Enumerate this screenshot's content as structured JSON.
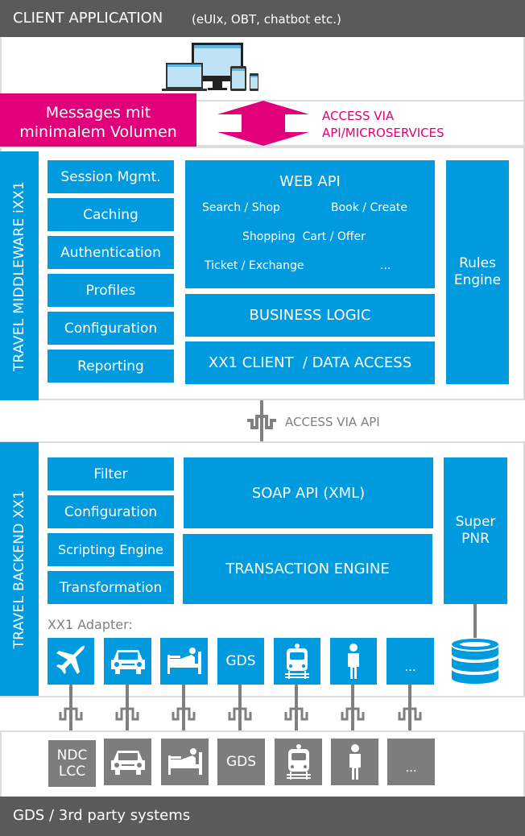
{
  "header": {
    "title": "CLIENT APPLICATION",
    "subtitle": "(eUIx, OBT, chatbot etc.)"
  },
  "client": {
    "devices_icon": "devices-icon",
    "message_box": {
      "line1": "Messages mit",
      "line2": "minimalem Volumen"
    },
    "access_label": {
      "line1": "ACCESS VIA",
      "line2": "API/MICROSERVICES"
    },
    "accent_color": "#e2007a"
  },
  "middleware": {
    "label": "TRAVEL MIDDLEWARE iXX1",
    "modules": [
      "Session Mgmt.",
      "Caching",
      "Authentication",
      "Profiles",
      "Configuration",
      "Reporting"
    ],
    "web_api": {
      "title": "WEB API",
      "items": [
        "Search / Shop",
        "Book / Create",
        "Shopping  Cart / Offer",
        "Ticket / Exchange",
        "..."
      ]
    },
    "business_logic": "BUSINESS LOGIC",
    "client_access": "XX1 CLIENT  / DATA ACCESS",
    "rules_engine": {
      "line1": "Rules",
      "line2": "Engine"
    }
  },
  "connector": {
    "label": "ACCESS VIA API"
  },
  "backend": {
    "label": "TRAVEL BACKEND XX1",
    "modules": [
      "Filter",
      "Configuration",
      "Scripting Engine",
      "Transformation"
    ],
    "soap_api": "SOAP API (XML)",
    "transaction_engine": "TRANSACTION ENGINE",
    "super_pnr": {
      "line1": "Super",
      "line2": "PNR"
    },
    "adapter_label": "XX1 Adapter:",
    "adapters": [
      {
        "icon": "airplane-icon"
      },
      {
        "icon": "car-icon"
      },
      {
        "icon": "hotel-bed-icon"
      },
      {
        "text": "GDS"
      },
      {
        "icon": "train-icon"
      },
      {
        "icon": "person-icon"
      },
      {
        "text": "..."
      }
    ],
    "database_icon": "database-icon"
  },
  "third_party": {
    "systems": [
      {
        "text": "NDC\nLCC",
        "line1": "NDC",
        "line2": "LCC"
      },
      {
        "icon": "car-icon"
      },
      {
        "icon": "hotel-bed-icon"
      },
      {
        "text": "GDS"
      },
      {
        "icon": "train-icon"
      },
      {
        "icon": "person-icon"
      },
      {
        "text": "..."
      }
    ],
    "footer": "GDS / 3rd party systems"
  },
  "colors": {
    "blue": "#009ade",
    "magenta": "#e2007a",
    "dark_grey": "#5a5a5a",
    "mid_grey": "#7d7d7d"
  }
}
